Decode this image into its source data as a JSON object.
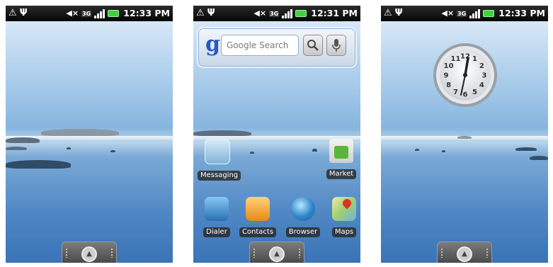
{
  "screens": [
    {
      "status_time": "12:33 PM",
      "network": "3G"
    },
    {
      "status_time": "12:31 PM",
      "network": "3G",
      "search": {
        "placeholder": "Google Search"
      },
      "apps": {
        "messaging": "Messaging",
        "market": "Market",
        "dialer": "Dialer",
        "contacts": "Contacts",
        "browser": "Browser",
        "maps": "Maps"
      }
    },
    {
      "status_time": "12:33 PM",
      "network": "3G",
      "clock_numerals": [
        "12",
        "1",
        "2",
        "3",
        "4",
        "5",
        "6",
        "7",
        "8",
        "9",
        "10",
        "11"
      ]
    }
  ],
  "colors": {
    "statusbar": "#111111",
    "battery": "#3fd23f",
    "sky_top": "#d7e8f6",
    "water_bottom": "#3a74b7",
    "label_bg": "#282828",
    "google_blue": "#2857c7"
  },
  "icons": {
    "status_left": [
      "alert-triangle-icon",
      "usb-icon"
    ],
    "status_right": [
      "mute-icon",
      "3g-icon",
      "signal-icon",
      "battery-icon"
    ],
    "search": [
      "search-magnifier-icon",
      "microphone-icon"
    ],
    "dock": "launcher-up-icon"
  }
}
